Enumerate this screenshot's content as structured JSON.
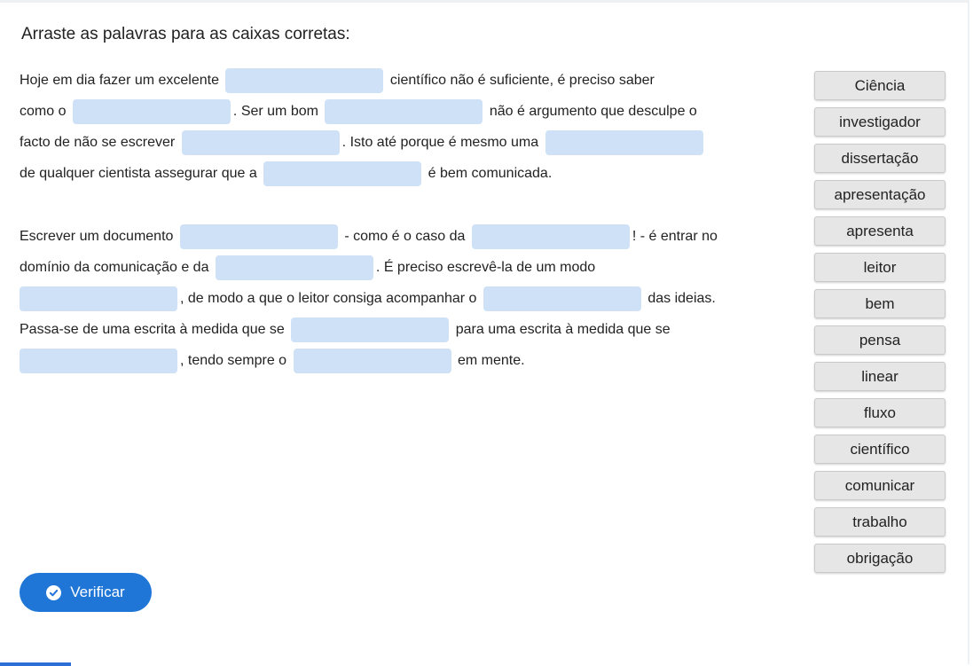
{
  "title": "Arraste as palavras para as caixas corretas:",
  "paragraph1": {
    "l1a": "Hoje em dia fazer um excelente",
    "l1b": "científico não é suficiente, é preciso saber",
    "l2a": "como o",
    "l2b": ". Ser um bom",
    "l2c": "não é argumento que desculpe o",
    "l3a": "facto de não se escrever",
    "l3b": ". Isto até porque é mesmo uma",
    "l4a": "de qualquer cientista assegurar que a",
    "l4b": "é bem comunicada."
  },
  "paragraph2": {
    "l1a": "Escrever um documento",
    "l1b": "- como é o caso da",
    "l1c": "! - é entrar no",
    "l2a": "domínio da comunicação e da",
    "l2b": ". É preciso escrevê-la de um modo",
    "l3a": ", de modo a que o leitor consiga acompanhar o",
    "l3b": "das ideias.",
    "l4a": "Passa-se de uma escrita à medida que se",
    "l4b": "para uma escrita à medida que se",
    "l5a": ", tendo sempre o",
    "l5b": "em mente."
  },
  "words": [
    "Ciência",
    "investigador",
    "dissertação",
    "apresentação",
    "apresenta",
    "leitor",
    "bem",
    "pensa",
    "linear",
    "fluxo",
    "científico",
    "comunicar",
    "trabalho",
    "obrigação"
  ],
  "verify_label": "Verificar",
  "verify_icon": "check-circle-icon",
  "colors": {
    "accent": "#1f76d7",
    "gap": "#cfe1f6",
    "word_bg": "#e6e6e6"
  }
}
